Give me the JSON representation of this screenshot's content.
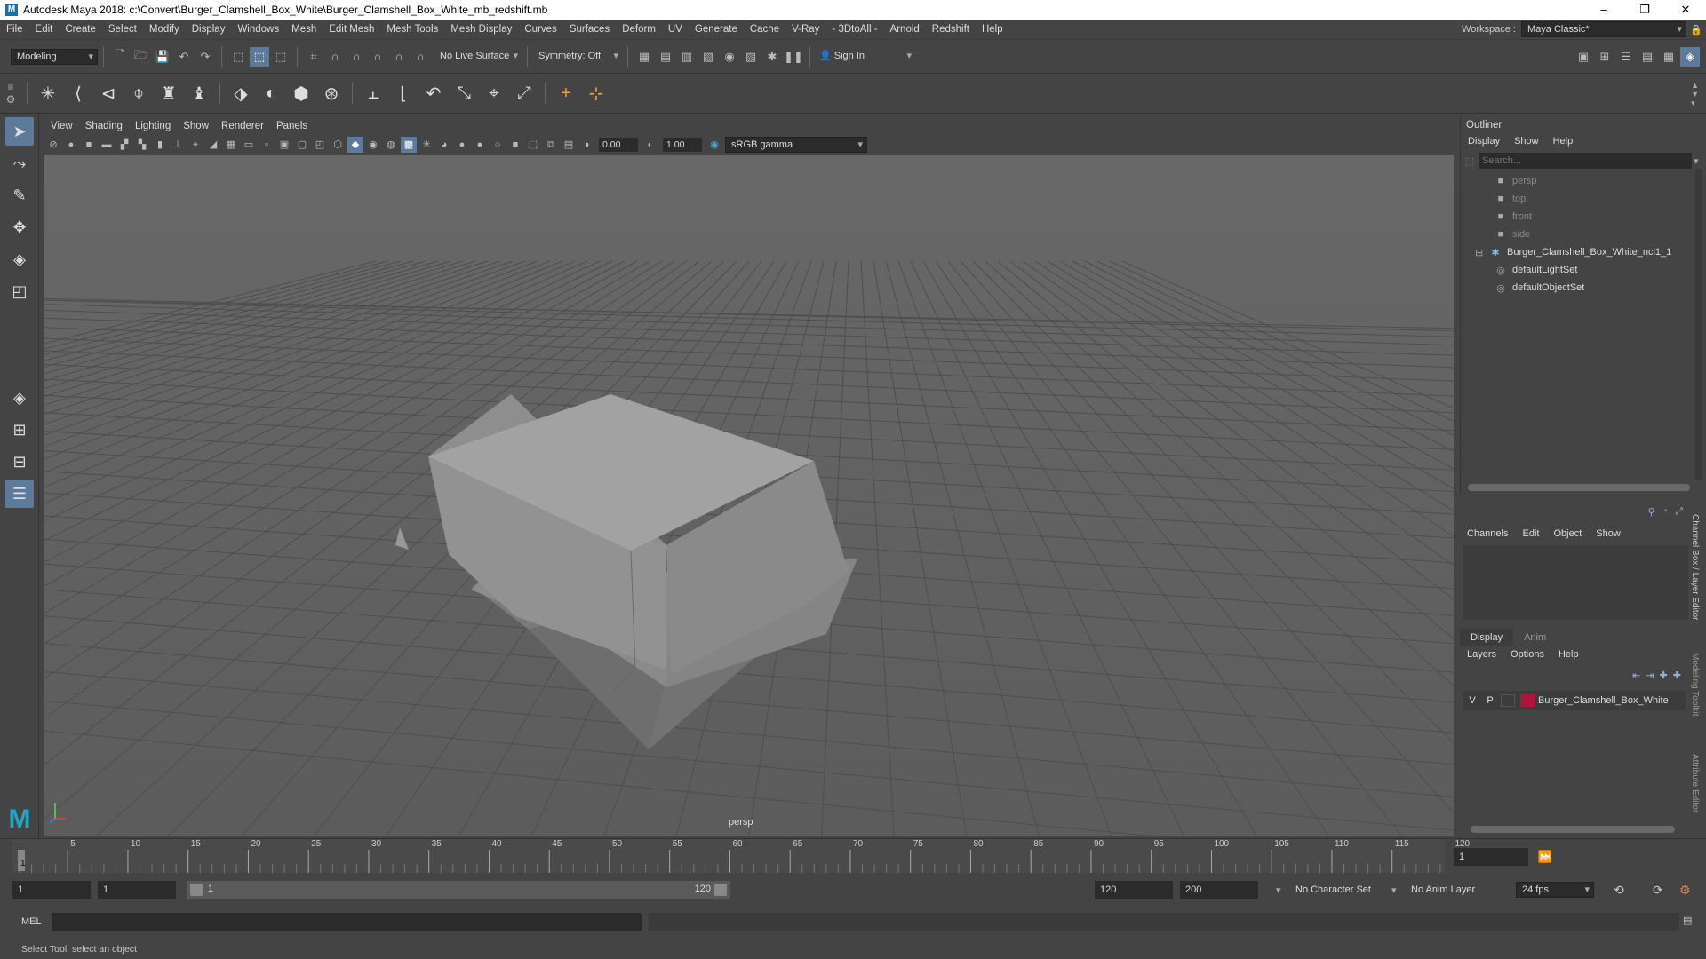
{
  "window": {
    "title": "Autodesk Maya 2018: c:\\Convert\\Burger_Clamshell_Box_White\\Burger_Clamshell_Box_White_mb_redshift.mb",
    "app_icon": "M",
    "min": "–",
    "max": "❐",
    "close": "✕"
  },
  "menubar": {
    "items": [
      "File",
      "Edit",
      "Create",
      "Select",
      "Modify",
      "Display",
      "Windows",
      "Mesh",
      "Edit Mesh",
      "Mesh Tools",
      "Mesh Display",
      "Curves",
      "Surfaces",
      "Deform",
      "UV",
      "Generate",
      "Cache",
      "V-Ray",
      "- 3DtoAll -",
      "Arnold",
      "Redshift",
      "Help"
    ],
    "workspace_label": "Workspace :",
    "workspace_value": "Maya Classic*"
  },
  "statusline": {
    "mode": "Modeling",
    "live_surface": "No Live Surface",
    "symmetry": "Symmetry: Off",
    "sign_in": "Sign In"
  },
  "viewport": {
    "menu": [
      "View",
      "Shading",
      "Lighting",
      "Show",
      "Renderer",
      "Panels"
    ],
    "exposure": "0.00",
    "gamma": "1.00",
    "color_space": "sRGB gamma",
    "camera_label": "persp"
  },
  "outliner": {
    "title": "Outliner",
    "menu": [
      "Display",
      "Show",
      "Help"
    ],
    "search_placeholder": "Search...",
    "items": [
      {
        "label": "persp",
        "dim": true,
        "icon": "camera-icon"
      },
      {
        "label": "top",
        "dim": true,
        "icon": "camera-icon"
      },
      {
        "label": "front",
        "dim": true,
        "icon": "camera-icon"
      },
      {
        "label": "side",
        "dim": true,
        "icon": "camera-icon"
      },
      {
        "label": "Burger_Clamshell_Box_White_ncl1_1",
        "dim": false,
        "icon": "group-icon"
      },
      {
        "label": "defaultLightSet",
        "dim": false,
        "icon": "set-icon"
      },
      {
        "label": "defaultObjectSet",
        "dim": false,
        "icon": "set-icon"
      }
    ]
  },
  "channelbox": {
    "menu": [
      "Channels",
      "Edit",
      "Object",
      "Show"
    ]
  },
  "layereditor": {
    "tabs": [
      "Display",
      "Anim"
    ],
    "menu": [
      "Layers",
      "Options",
      "Help"
    ],
    "layer": {
      "v": "V",
      "p": "P",
      "name": "Burger_Clamshell_Box_White",
      "color": "#b0143c"
    }
  },
  "side_tabs": [
    "Channel Box / Layer Editor",
    "Modeling Toolkit",
    "Attribute Editor"
  ],
  "timeline": {
    "ticks": [
      "5",
      "10",
      "15",
      "20",
      "25",
      "30",
      "35",
      "40",
      "45",
      "50",
      "55",
      "60",
      "65",
      "70",
      "75",
      "80",
      "85",
      "90",
      "95",
      "100",
      "105",
      "110",
      "115",
      "120"
    ],
    "start_marker": "1",
    "current_frame": "1"
  },
  "range": {
    "start": "1",
    "playback_start": "1",
    "slider_start": "1",
    "slider_end": "120",
    "playback_end": "120",
    "end": "200",
    "character_set": "No Character Set",
    "anim_layer": "No Anim Layer",
    "fps": "24 fps"
  },
  "mel": {
    "label": "MEL"
  },
  "help_line": "Select Tool: select an object"
}
